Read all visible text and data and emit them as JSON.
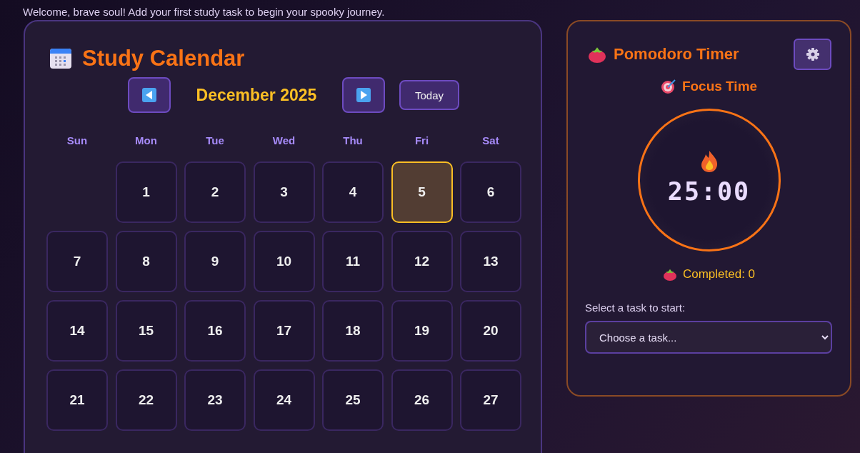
{
  "welcome": "Welcome, brave soul! Add your first study task to begin your spooky journey.",
  "calendar": {
    "title": "Study Calendar",
    "month": "December 2025",
    "today_button": "Today",
    "weekdays": [
      "Sun",
      "Mon",
      "Tue",
      "Wed",
      "Thu",
      "Fri",
      "Sat"
    ],
    "days": [
      {
        "kind": "blank"
      },
      {
        "kind": "day",
        "label": "1",
        "today": false
      },
      {
        "kind": "day",
        "label": "2",
        "today": false
      },
      {
        "kind": "day",
        "label": "3",
        "today": false
      },
      {
        "kind": "day",
        "label": "4",
        "today": false
      },
      {
        "kind": "day",
        "label": "5",
        "today": true
      },
      {
        "kind": "day",
        "label": "6",
        "today": false
      },
      {
        "kind": "day",
        "label": "7",
        "today": false
      },
      {
        "kind": "day",
        "label": "8",
        "today": false
      },
      {
        "kind": "day",
        "label": "9",
        "today": false
      },
      {
        "kind": "day",
        "label": "10",
        "today": false
      },
      {
        "kind": "day",
        "label": "11",
        "today": false
      },
      {
        "kind": "day",
        "label": "12",
        "today": false
      },
      {
        "kind": "day",
        "label": "13",
        "today": false
      },
      {
        "kind": "day",
        "label": "14",
        "today": false
      },
      {
        "kind": "day",
        "label": "15",
        "today": false
      },
      {
        "kind": "day",
        "label": "16",
        "today": false
      },
      {
        "kind": "day",
        "label": "17",
        "today": false
      },
      {
        "kind": "day",
        "label": "18",
        "today": false
      },
      {
        "kind": "day",
        "label": "19",
        "today": false
      },
      {
        "kind": "day",
        "label": "20",
        "today": false
      },
      {
        "kind": "day",
        "label": "21",
        "today": false
      },
      {
        "kind": "day",
        "label": "22",
        "today": false
      },
      {
        "kind": "day",
        "label": "23",
        "today": false
      },
      {
        "kind": "day",
        "label": "24",
        "today": false
      },
      {
        "kind": "day",
        "label": "25",
        "today": false
      },
      {
        "kind": "day",
        "label": "26",
        "today": false
      },
      {
        "kind": "day",
        "label": "27",
        "today": false
      }
    ]
  },
  "timer": {
    "title": "Pomodoro Timer",
    "mode": "Focus Time",
    "time": "25:00",
    "completed": "Completed: 0",
    "task_label": "Select a task to start:",
    "task_placeholder": "Choose a task..."
  }
}
